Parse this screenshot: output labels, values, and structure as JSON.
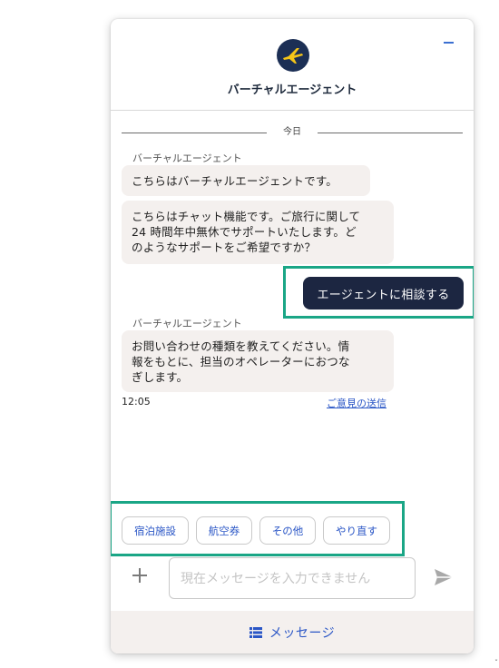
{
  "header": {
    "title": "バーチャルエージェント",
    "logo_color": "#1c2f55",
    "logo_accent": "#f5c518"
  },
  "chat": {
    "date_divider": "今日",
    "messages": [
      {
        "sender": "バーチャルエージェント",
        "lines": [
          "こちらはバーチャルエージェントです。"
        ]
      },
      {
        "lines": [
          "こちらはチャット機能です。ご旅行に関して",
          "24 時間年中無休でサポートいたします。ど",
          "のようなサポートをご希望ですか？"
        ]
      },
      {
        "sender": "バーチャルエージェント",
        "lines": [
          "お問い合わせの種類を教えてください。情",
          "報をもとに、担当のオペレーターにおつな",
          "ぎします。"
        ]
      }
    ],
    "user_reply": "エージェントに相談する",
    "timestamp": "12:05",
    "feedback_link": "ご意見の送信"
  },
  "quick_replies": [
    "宿泊施設",
    "航空券",
    "その他",
    "やり直す"
  ],
  "composer": {
    "placeholder": "現在メッセージを入力できません",
    "plus_icon": "plus-icon",
    "send_icon": "send-icon"
  },
  "footer": {
    "label": "メッセージ",
    "icon": "list-icon"
  },
  "colors": {
    "accent": "#2a56c6",
    "dark_button": "#1c2641",
    "highlight": "#1aa686",
    "bubble": "#f4f0ee"
  }
}
